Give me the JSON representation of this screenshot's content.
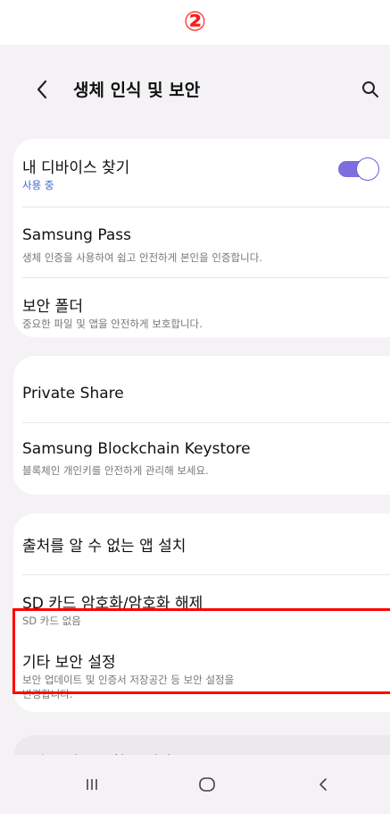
{
  "step_marker": "②",
  "header": {
    "title": "생체 인식 및 보안",
    "back_icon": "back-chevron-icon",
    "search_icon": "search-icon"
  },
  "groups": [
    {
      "items": [
        {
          "title": "내 디바이스 찾기",
          "subtitle": "사용 중",
          "toggle": true
        },
        {
          "title": "Samsung Pass",
          "subtitle": "생체 인증을 사용하여 쉽고 안전하게 본인을 인증합니다."
        },
        {
          "title": "보안 폴더",
          "subtitle": "중요한 파일 및 앱을 안전하게 보호합니다."
        }
      ]
    },
    {
      "items": [
        {
          "title": "Private Share"
        },
        {
          "title": "Samsung Blockchain Keystore",
          "subtitle": "블록체인 개인키를 안전하게 관리해 보세요."
        }
      ]
    },
    {
      "items": [
        {
          "title": "출처를 알 수 없는 앱 설치"
        },
        {
          "title": "SD 카드 암호화/암호화 해제",
          "subtitle": "SD 카드 없음"
        },
        {
          "title": "기타 보안 설정",
          "subtitle_line1": "보안 업데이트 및 인증서 저장공간 등 보안 설정을",
          "subtitle_line2": "변경합니다.",
          "highlighted": true
        }
      ]
    }
  ],
  "footer_peek": "다른 기능을 찾고 있나요?",
  "colors": {
    "accent": "#7c6ee0",
    "subtitle_accent": "#3b63d6",
    "highlight": "#ff0000",
    "background": "#f4f2f5"
  },
  "navbar": {
    "icons": [
      "recent-apps-icon",
      "home-icon",
      "back-icon"
    ]
  }
}
